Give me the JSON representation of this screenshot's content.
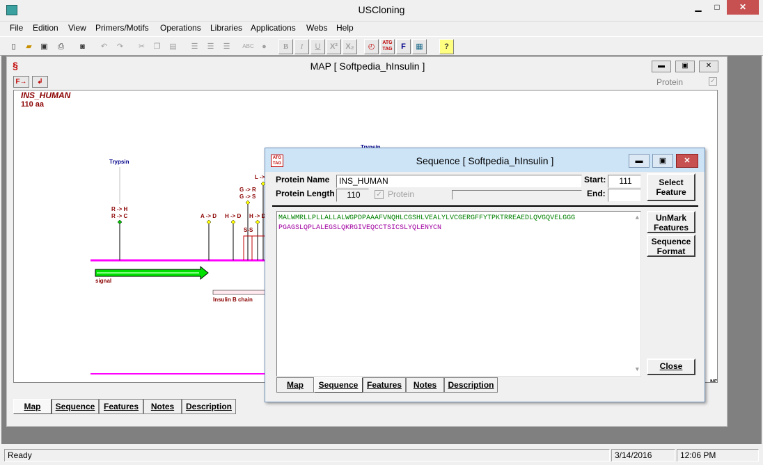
{
  "app": {
    "title": "USCloning"
  },
  "menu": [
    "File",
    "Edition",
    "View",
    "Primers/Motifs",
    "Operations",
    "Libraries",
    "Applications",
    "Webs",
    "Help"
  ],
  "toolbar": {
    "icons": [
      "new-file-icon",
      "open-folder-icon",
      "save-icon",
      "print-icon",
      "camera-icon",
      "undo-icon",
      "redo-icon",
      "cut-icon",
      "copy-icon",
      "paste-icon",
      "align-left-icon",
      "align-center-icon",
      "align-right-icon",
      "abc-icon",
      "color-icon",
      "bold-icon",
      "italic-icon",
      "underline-icon",
      "superscript-icon",
      "subscript-icon",
      "map-icon",
      "atg-translate-icon",
      "features-icon",
      "grid-icon",
      "help-icon"
    ],
    "labels": {
      "bold": "B",
      "italic": "I",
      "underline": "U",
      "superscript": "X²",
      "subscript": "X₂",
      "atg": "ATG TAG",
      "f": "F",
      "abc": "ABC",
      "help": "?"
    }
  },
  "map_window": {
    "title": "MAP   [ Softpedia_hInsulin ]",
    "protein_label": "Protein",
    "name": "INS_HUMAN",
    "length": "110 aa",
    "annotations": {
      "trypsin_left": "Trypsin",
      "trypsin_right": "Trypsin",
      "rh": "R -> H",
      "rc": "R -> C",
      "ad": "A -> D",
      "hd1": "H -> D",
      "hd2": "H -> D",
      "gr": "G -> R",
      "gs": "G -> S",
      "l": "L ->",
      "ss": "S-S",
      "signal": "signal",
      "insulin_b": "Insulin B chain",
      "nd": "ND"
    },
    "tabs": [
      "Map",
      "Sequence",
      "Features",
      "Notes",
      "Description"
    ],
    "active_tab": "Map"
  },
  "sequence_window": {
    "title": "Sequence  [ Softpedia_hInsulin ]",
    "protein_name_label": "Protein Name",
    "protein_name": "INS_HUMAN",
    "protein_length_label": "Protein Length",
    "protein_length": "110",
    "protein_checkbox_label": "Protein",
    "start_label": "Start:",
    "start_value": "111",
    "end_label": "End:",
    "end_value": "",
    "buttons": {
      "select_feature": "Select Feature",
      "unmark_features": "UnMark Features",
      "sequence_format": "Sequence Format",
      "close": "Close"
    },
    "sequence_line1": "MALWMRLLPLLALLALWGPDPAAAFVNQHLCGSHLVEALYLVCGERGFFYTPKTRREAEDLQVGQVELGGG",
    "sequence_line2": "PGAGSLQPLALEGSLQKRGIVEQCCTSICSLYQLENYCN",
    "tabs": [
      "Map",
      "Sequence",
      "Features",
      "Notes",
      "Description"
    ],
    "active_tab": "Sequence",
    "colors": {
      "hydrophobic": "#008000",
      "charged": "#c00000",
      "polar": "#0000c0",
      "special": "#a000a0"
    }
  },
  "status": {
    "text": "Ready",
    "date": "3/14/2016",
    "time": "12:06 PM"
  }
}
